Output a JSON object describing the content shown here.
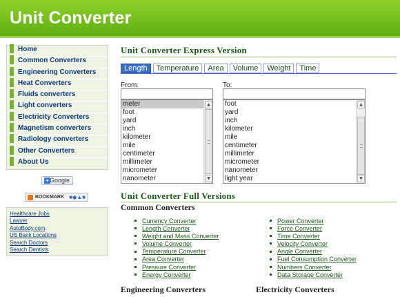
{
  "header": {
    "title": "Unit Converter"
  },
  "sidebar": {
    "items": [
      "Home",
      "Common Converters",
      "Engineering Converters",
      "Heat Converters",
      "Fluids converters",
      "Light converters",
      "Electricity Converters",
      "Magnetism converters",
      "Radiology converters",
      "Other Converters",
      "About Us"
    ],
    "google_button": "Google",
    "bookmark_button": "BOOKMARK",
    "links": [
      "Healthcare Jobs",
      "Lawyer",
      "AutoBody.com",
      "US Bank Locations",
      "Search Doctors",
      "Search Dentists"
    ]
  },
  "express": {
    "title": "Unit Converter Express Version",
    "tabs": [
      "Length",
      "Temperature",
      "Area",
      "Volume",
      "Weight",
      "Time"
    ],
    "active_tab": "Length",
    "from_label": "From:",
    "to_label": "To:",
    "from_value": "",
    "to_value": "",
    "from_units": [
      "meter",
      "foot",
      "yard",
      "inch",
      "kilometer",
      "mile",
      "centimeter",
      "millimeter",
      "micrometer",
      "nanometer"
    ],
    "from_selected": "meter",
    "to_units": [
      "foot",
      "yard",
      "inch",
      "kilometer",
      "mile",
      "centimeter",
      "millimeter",
      "micrometer",
      "nanometer",
      "light year"
    ]
  },
  "full": {
    "title": "Unit Converter Full Versions",
    "common_title": "Common Converters",
    "common_left": [
      "Currency Converter",
      "Length Converter",
      "Weight and Mass Converter",
      "Volume Converter",
      "Temperature Converter",
      "Area Converter",
      "Pressure Converter",
      "Energy Converter"
    ],
    "common_right": [
      "Power Converter",
      "Force Converter",
      "Time Converter",
      "Velocity Converter",
      "Angle Converter",
      "Fuel Consumption Converter",
      "Numbers Converter",
      "Data Storage Converter"
    ],
    "engineering_title": "Engineering Converters",
    "electricity_title": "Electricity Converters"
  },
  "colors": {
    "header_green": "#6dbd1c",
    "title_green": "#1c5a17",
    "nav_link_blue": "#0a3a7a",
    "active_tab_blue": "#3b6fc4"
  }
}
